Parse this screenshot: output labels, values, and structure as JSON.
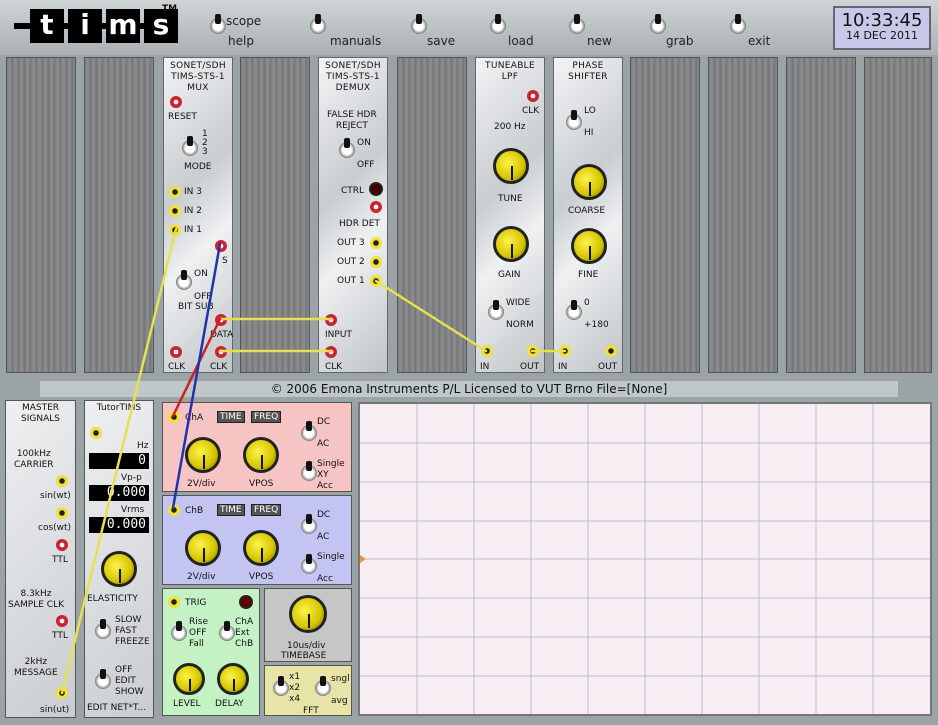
{
  "app": {
    "logo": "tims",
    "trademark": "TM"
  },
  "menu": [
    {
      "key": "scope",
      "label": "scope",
      "label2": "help"
    },
    {
      "key": "manuals",
      "label": "manuals"
    },
    {
      "key": "save",
      "label": "save"
    },
    {
      "key": "load",
      "label": "load"
    },
    {
      "key": "new",
      "label": "new"
    },
    {
      "key": "grab",
      "label": "grab"
    },
    {
      "key": "exit",
      "label": "exit"
    }
  ],
  "clock": {
    "time": "10:33:45",
    "date": "14 DEC 2011"
  },
  "mux": {
    "title": [
      "SONET/SDH",
      "TIMS-STS-1",
      "MUX"
    ],
    "reset": "RESET",
    "mode": "MODE",
    "mode_opts": [
      "1",
      "2",
      "3"
    ],
    "in3": "IN 3",
    "in2": "IN 2",
    "in1": "IN 1",
    "s": "S",
    "on": "ON",
    "off": "OFF",
    "bitsub": "BIT SUB",
    "data": "DATA",
    "clk1": "CLK",
    "clk2": "CLK"
  },
  "demux": {
    "title": [
      "SONET/SDH",
      "TIMS-STS-1",
      "DEMUX"
    ],
    "fhr": [
      "FALSE HDR",
      "REJECT"
    ],
    "on": "ON",
    "off": "OFF",
    "ctrl": "CTRL",
    "hdrdet": "HDR DET",
    "out3": "OUT 3",
    "out2": "OUT 2",
    "out1": "OUT 1",
    "input": "INPUT",
    "clk": "CLK"
  },
  "lpf": {
    "title": [
      "TUNEABLE",
      "LPF"
    ],
    "clk": "CLK",
    "freq": "200 Hz",
    "tune": "TUNE",
    "gain": "GAIN",
    "wide": "WIDE",
    "norm": "NORM",
    "in": "IN",
    "out": "OUT"
  },
  "phase": {
    "title": [
      "PHASE",
      "SHIFTER"
    ],
    "lo": "LO",
    "hi": "HI",
    "coarse": "COARSE",
    "fine": "FINE",
    "zero": "0",
    "p180": "+180",
    "in": "IN",
    "out": "OUT"
  },
  "status": "© 2006 Emona Instruments P/L  Licensed to VUT Brno     File=[None]",
  "master": {
    "title": [
      "MASTER",
      "SIGNALS"
    ],
    "carrier": [
      "100kHz",
      "CARRIER"
    ],
    "sin": "sin(wt)",
    "cos": "cos(wt)",
    "ttl": "TTL",
    "sample": [
      "8.3kHz",
      "SAMPLE CLK"
    ],
    "ttl2": "TTL",
    "message": [
      "2kHz",
      "MESSAGE"
    ],
    "sinu": "sin(ut)"
  },
  "tutor": {
    "title": "TutorTIMS",
    "hz": "Hz",
    "hz_val": "0",
    "vpp": "Vp-p",
    "vpp_val": "0.000",
    "vrms": "Vrms",
    "vrms_val": "0.000",
    "elasticity": "ELASTICITY",
    "slow": "SLOW",
    "fast": "FAST",
    "freeze": "FREEZE",
    "off": "OFF",
    "edit": "EDIT",
    "show": "SHOW",
    "editnet": "EDIT NET*T..."
  },
  "scope": {
    "chA": {
      "name": "ChA",
      "time": "TIME",
      "freq": "FREQ",
      "dc": "DC",
      "ac": "AC",
      "single": "Single",
      "xy": "XY",
      "acc": "Acc",
      "vdiv": "2V/div",
      "vpos": "VPOS"
    },
    "chB": {
      "name": "ChB",
      "time": "TIME",
      "freq": "FREQ",
      "dc": "DC",
      "ac": "AC",
      "single": "Single",
      "acc": "Acc",
      "vdiv": "2V/div",
      "vpos": "VPOS"
    },
    "trig": {
      "trig": "TRIG",
      "rise": "Rise",
      "off": "OFF",
      "fall": "Fall",
      "cha": "ChA",
      "ext": "Ext",
      "chb": "ChB",
      "level": "LEVEL",
      "delay": "DELAY"
    },
    "timebase": {
      "value": "10us/div",
      "label": "TIMEBASE"
    },
    "fft": {
      "x1": "x1",
      "x2": "x2",
      "x4": "x4",
      "sngl": "sngl",
      "avg": "avg",
      "label": "FFT"
    }
  },
  "colors": {
    "wire_yellow": "#e8e050",
    "wire_red": "#cc2222",
    "wire_blue": "#2233aa",
    "chA_panel": "#f7c4c4",
    "chB_panel": "#c4c4f2",
    "trig_panel": "#c4f2c4",
    "fft_panel": "#e8e4a8"
  }
}
